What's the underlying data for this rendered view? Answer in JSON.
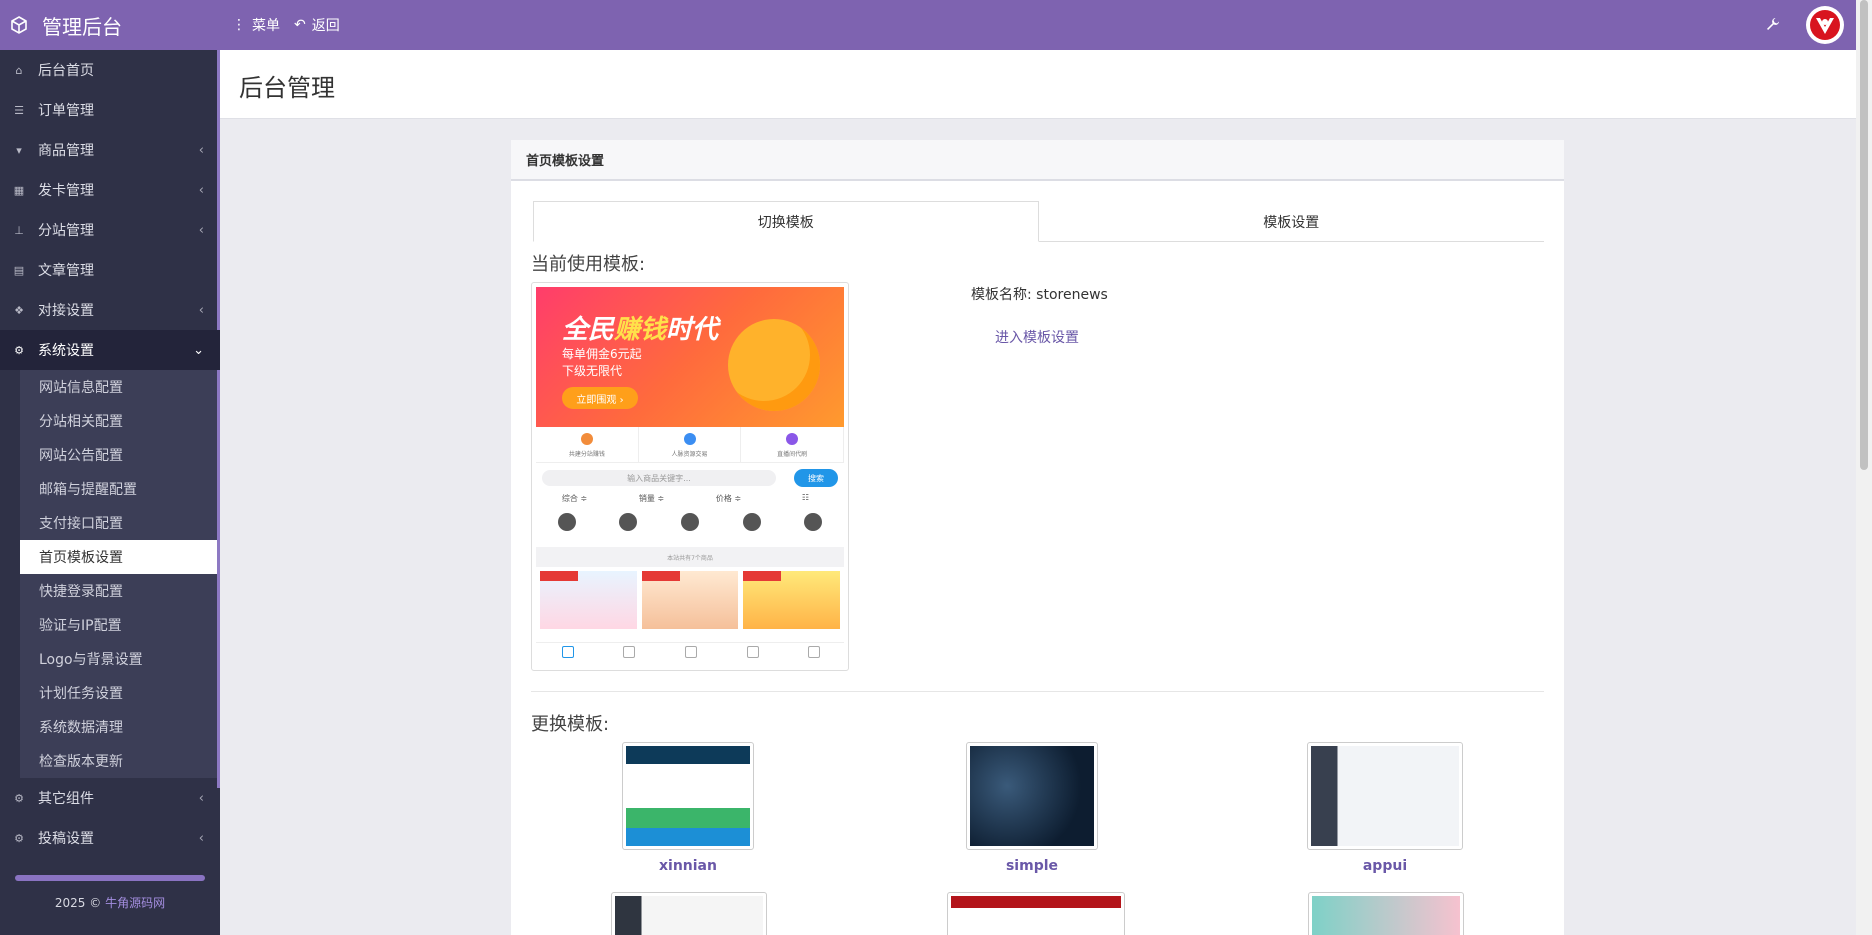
{
  "header": {
    "brand": "管理后台",
    "menu_label": "菜单",
    "back_label": "返回"
  },
  "sidebar": {
    "items": [
      {
        "label": "后台首页",
        "icon": "home-icon"
      },
      {
        "label": "订单管理",
        "icon": "list-icon"
      },
      {
        "label": "商品管理",
        "icon": "cart-icon"
      },
      {
        "label": "发卡管理",
        "icon": "grid-icon"
      },
      {
        "label": "分站管理",
        "icon": "sitemap-icon"
      },
      {
        "label": "文章管理",
        "icon": "book-icon"
      },
      {
        "label": "对接设置",
        "icon": "cubes-icon"
      },
      {
        "label": "系统设置",
        "icon": "gear-icon"
      }
    ],
    "system_sub": [
      "网站信息配置",
      "分站相关配置",
      "网站公告配置",
      "邮箱与提醒配置",
      "支付接口配置",
      "首页模板设置",
      "快捷登录配置",
      "验证与IP配置",
      "Logo与背景设置",
      "计划任务设置",
      "系统数据清理",
      "检查版本更新"
    ],
    "bottom_items": [
      {
        "label": "其它组件",
        "icon": "cogs-icon"
      },
      {
        "label": "投稿设置",
        "icon": "cogs-icon"
      }
    ],
    "footer_prefix": "2025 © ",
    "footer_link": "牛角源码网"
  },
  "page": {
    "title": "后台管理",
    "panel_title": "首页模板设置",
    "tabs": [
      "切换模板",
      "模板设置"
    ],
    "current_heading": "当前使用模板:",
    "template_name_text": "模板名称: storenews",
    "enter_settings": "进入模板设置",
    "change_heading": "更换模板:"
  },
  "preview": {
    "banner_prefix": "全民",
    "banner_highlight": "赚钱",
    "banner_suffix": "时代",
    "banner_line1": "每单佣金6元起",
    "banner_line2": "下级无限代",
    "banner_cta": "立即围观 ›",
    "quick_links": [
      "共建分站赚钱",
      "人脉资源交易",
      "直播间代刷"
    ],
    "search_placeholder": "输入商品关键字...",
    "search_button": "搜索",
    "sort_options": [
      "综合 ≑",
      "销量 ≑",
      "价格 ≑",
      "☷"
    ],
    "divider": "本站共有7个商品"
  },
  "templates": [
    {
      "name": "xinnian"
    },
    {
      "name": "simple"
    },
    {
      "name": "appui"
    }
  ],
  "colors": {
    "header": "#7e63b0",
    "sidebar": "#2f3147",
    "link": "#6a58a8"
  }
}
